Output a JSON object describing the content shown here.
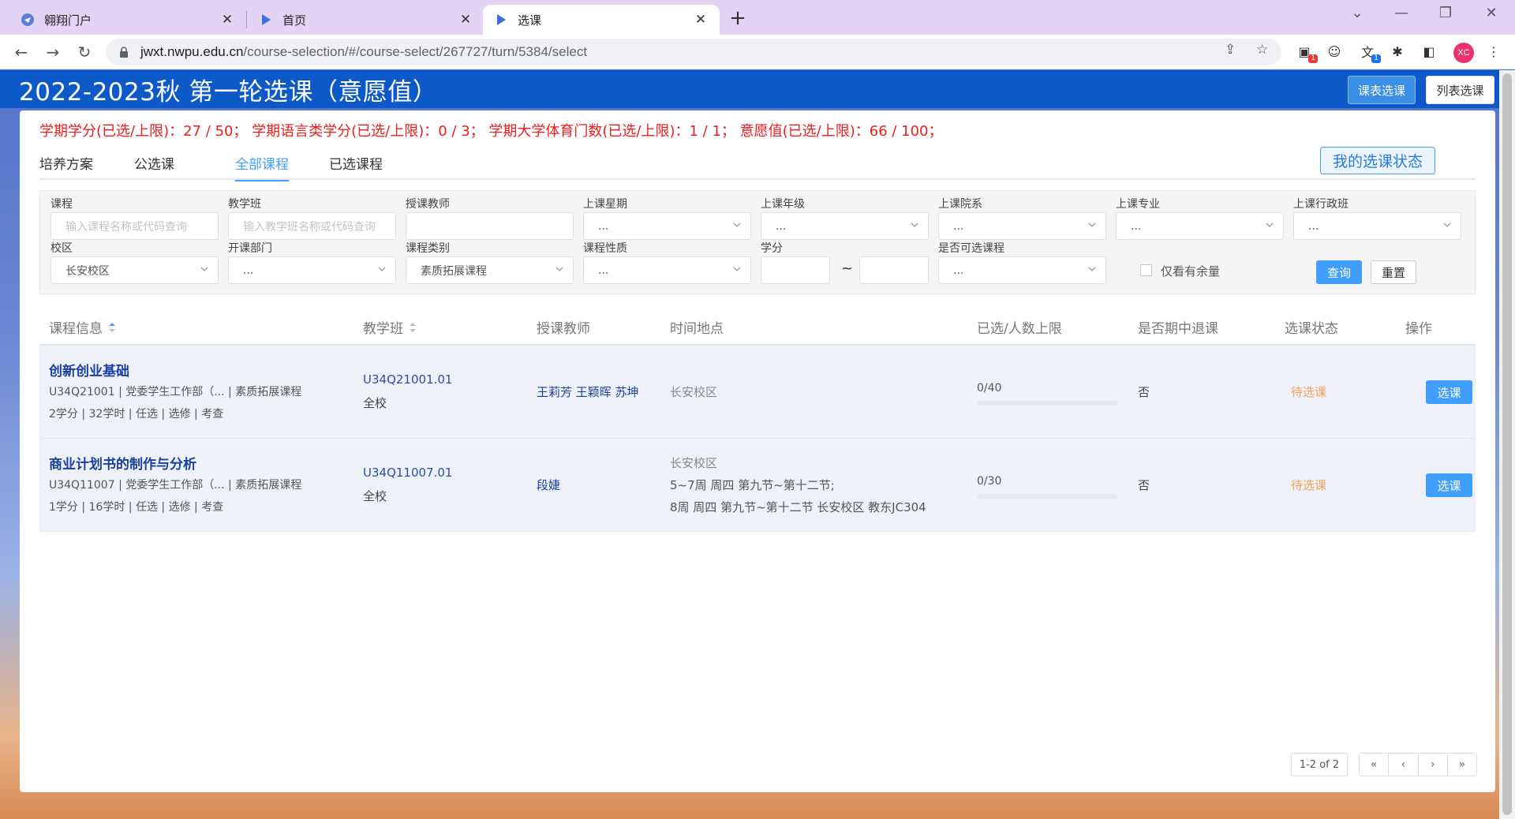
{
  "browser": {
    "tabs": [
      {
        "title": "翱翔门户",
        "active": false
      },
      {
        "title": "首页",
        "active": false
      },
      {
        "title": "选课",
        "active": true
      }
    ],
    "url_host": "jwxt.nwpu.edu.cn",
    "url_path": "/course-selection/#/course-select/267727/turn/5384/select",
    "extensions": [
      {
        "icon": "message-extension-icon",
        "badge": "1"
      },
      {
        "icon": "face-extension-icon",
        "badge": ""
      },
      {
        "icon": "translate-extension-icon",
        "badge": "1"
      }
    ],
    "avatar_text": "XC"
  },
  "header": {
    "title": "2022-2023秋 第一轮选课（意愿值）",
    "timetable_button": "课表选课",
    "list_button": "列表选课"
  },
  "credits_summary": "学期学分(已选/上限)：27 / 50；  学期语言类学分(已选/上限)：0 / 3；  学期大学体育门数(已选/上限)：1 / 1；  意愿值(已选/上限)：66 / 100；",
  "page_tabs": [
    {
      "label": "培养方案",
      "active": false
    },
    {
      "label": "公选课",
      "active": false
    },
    {
      "label": "全部课程",
      "active": true
    },
    {
      "label": "已选课程",
      "active": false
    }
  ],
  "my_status_button": "我的选课状态",
  "filters": {
    "course": {
      "label": "课程",
      "placeholder": "输入课程名称或代码查询"
    },
    "teaching_class": {
      "label": "教学班",
      "placeholder": "输入教学班名称或代码查询"
    },
    "teacher": {
      "label": "授课教师",
      "value": ""
    },
    "weekday": {
      "label": "上课星期",
      "value": "..."
    },
    "grade": {
      "label": "上课年级",
      "value": "..."
    },
    "department": {
      "label": "上课院系",
      "value": "..."
    },
    "major": {
      "label": "上课专业",
      "value": "..."
    },
    "admin_class": {
      "label": "上课行政班",
      "value": "..."
    },
    "campus": {
      "label": "校区",
      "value": "长安校区"
    },
    "offering_dept": {
      "label": "开课部门",
      "value": "..."
    },
    "course_category": {
      "label": "课程类别",
      "value": "素质拓展课程"
    },
    "course_nature": {
      "label": "课程性质",
      "value": "..."
    },
    "credit": {
      "label": "学分",
      "tilde": "~"
    },
    "selectable": {
      "label": "是否可选课程",
      "value": "..."
    },
    "remaining_only": {
      "label": "仅看有余量",
      "checked": false
    },
    "query_button": "查询",
    "reset_button": "重置"
  },
  "table": {
    "headers": {
      "course_info": "课程信息",
      "teaching_class": "教学班",
      "teacher": "授课教师",
      "time_place": "时间地点",
      "enrollment": "已选/人数上限",
      "midterm_withdraw": "是否期中退课",
      "status": "选课状态",
      "action": "操作"
    },
    "rows": [
      {
        "name": "创新创业基础",
        "meta": "U34Q21001 | 党委学生工作部（...  | 素质拓展课程",
        "detail": "2学分 | 32学时 | 任选 | 选修 | 考查",
        "class_code": "U34Q21001.01",
        "scope": "全校",
        "teachers": "王莉芳 王颖晖 苏坤",
        "place_lines": [
          "长安校区"
        ],
        "enrollment": "0/40",
        "enrollment_ratio": 0.0,
        "withdraw": "否",
        "status": "待选课",
        "action": "选课"
      },
      {
        "name": "商业计划书的制作与分析",
        "meta": "U34Q11007 | 党委学生工作部（...  | 素质拓展课程",
        "detail": "1学分 | 16学时 | 任选 | 选修 | 考查",
        "class_code": "U34Q11007.01",
        "scope": "全校",
        "teachers": "段婕",
        "place_lines": [
          "长安校区",
          " 5~7周 周四 第九节~第十二节;",
          "8周 周四 第九节~第十二节 长安校区 教东JC304"
        ],
        "enrollment": "0/30",
        "enrollment_ratio": 0.0,
        "withdraw": "否",
        "status": "待选课",
        "action": "选课"
      }
    ]
  },
  "pagination": {
    "info": "1-2 of 2",
    "first": "«",
    "prev": "‹",
    "next": "›",
    "last": "»"
  }
}
